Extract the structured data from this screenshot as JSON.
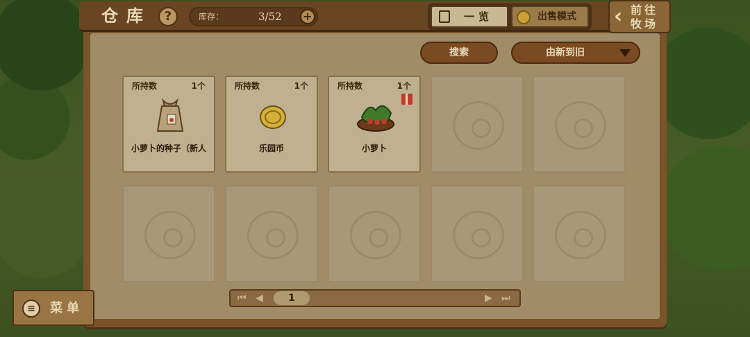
{
  "header": {
    "title": "仓库",
    "help_icon": "?",
    "stock_label": "库存：",
    "stock_value": "3/52",
    "stock_add": "+",
    "mode_list_label": "一览",
    "mode_sell_label": "出售模式",
    "goto_label": "前往牧场"
  },
  "toolbar": {
    "search_label": "搜索",
    "sort_label": "由新到旧"
  },
  "items": [
    {
      "count_label": "所持数",
      "count": "1个",
      "name": "小萝卜的种子（新人",
      "icon": "seed-bag-icon"
    },
    {
      "count_label": "所持数",
      "count": "1个",
      "name": "乐园币",
      "icon": "coin-icon"
    },
    {
      "count_label": "所持数",
      "count": "1个",
      "name": "小萝卜",
      "icon": "radish-basket-icon",
      "gift": true
    }
  ],
  "pager": {
    "current_page": "1"
  },
  "menu": {
    "label": "菜单"
  },
  "colors": {
    "panel_wood": "#7a5328",
    "card_paper": "#bfb08f",
    "text_dark": "#3f2810",
    "text_light": "#e8d9b6"
  }
}
